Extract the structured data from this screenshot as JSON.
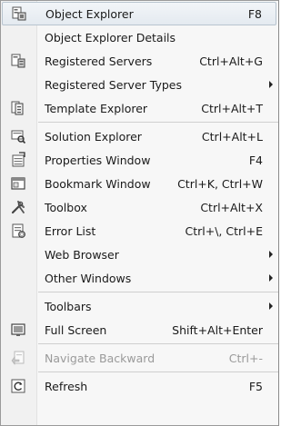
{
  "menu": {
    "items": [
      {
        "label": "Object Explorer",
        "shortcut": "F8",
        "icon": "object-explorer-icon"
      },
      {
        "label": "Object Explorer Details",
        "shortcut": "",
        "icon": ""
      },
      {
        "label": "Registered Servers",
        "shortcut": "Ctrl+Alt+G",
        "icon": "registered-servers-icon"
      },
      {
        "label": "Registered Server Types",
        "shortcut": "",
        "icon": "",
        "submenu": true
      },
      {
        "label": "Template Explorer",
        "shortcut": "Ctrl+Alt+T",
        "icon": "template-explorer-icon"
      },
      {
        "label": "Solution Explorer",
        "shortcut": "Ctrl+Alt+L",
        "icon": "solution-explorer-icon"
      },
      {
        "label": "Properties Window",
        "shortcut": "F4",
        "icon": "properties-window-icon"
      },
      {
        "label": "Bookmark Window",
        "shortcut": "Ctrl+K, Ctrl+W",
        "icon": "bookmark-window-icon"
      },
      {
        "label": "Toolbox",
        "shortcut": "Ctrl+Alt+X",
        "icon": "toolbox-icon"
      },
      {
        "label": "Error List",
        "shortcut": "Ctrl+\\, Ctrl+E",
        "icon": "error-list-icon"
      },
      {
        "label": "Web Browser",
        "shortcut": "",
        "icon": "",
        "submenu": true
      },
      {
        "label": "Other Windows",
        "shortcut": "",
        "icon": "",
        "submenu": true
      },
      {
        "label": "Toolbars",
        "shortcut": "",
        "icon": "",
        "submenu": true
      },
      {
        "label": "Full Screen",
        "shortcut": "Shift+Alt+Enter",
        "icon": "full-screen-icon"
      },
      {
        "label": "Navigate Backward",
        "shortcut": "Ctrl+-",
        "icon": "navigate-backward-icon",
        "disabled": true
      },
      {
        "label": "Refresh",
        "shortcut": "F5",
        "icon": "refresh-icon"
      }
    ]
  }
}
